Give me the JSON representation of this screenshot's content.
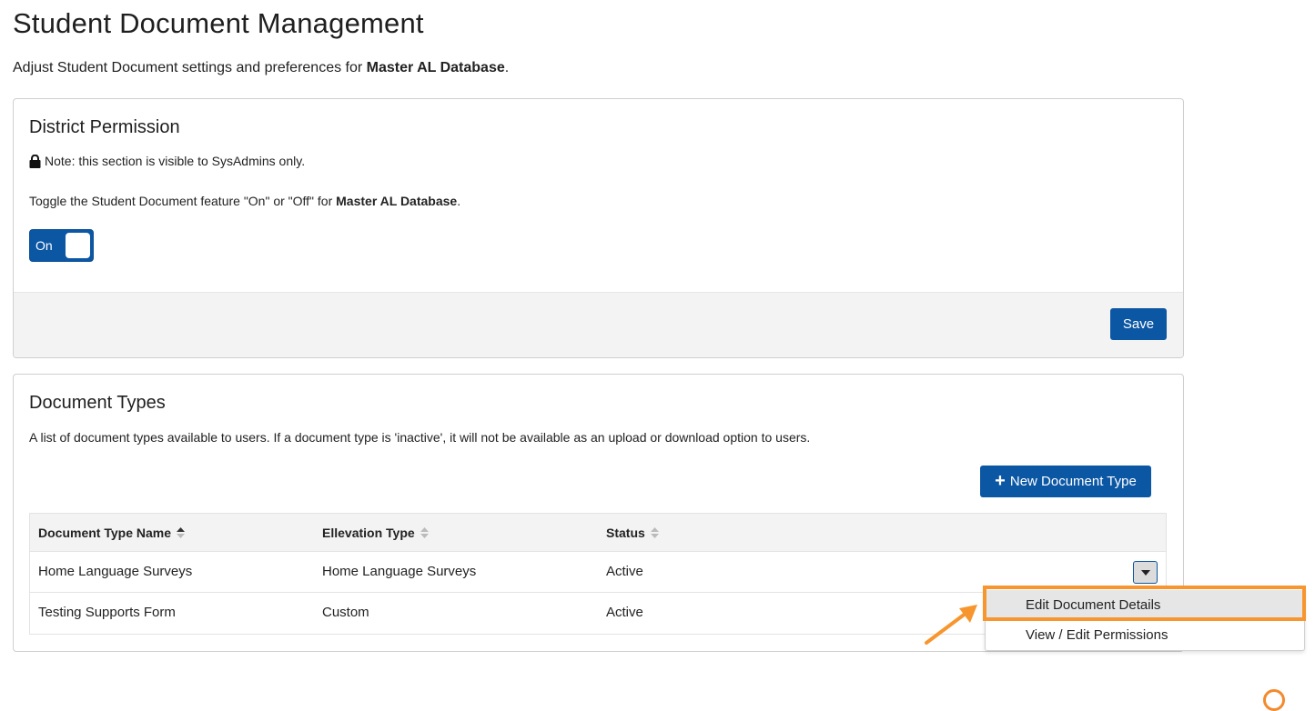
{
  "page": {
    "title": "Student Document Management",
    "subtitle_prefix": "Adjust Student Document settings and preferences for ",
    "database_name": "Master AL Database",
    "subtitle_suffix": "."
  },
  "district_permission": {
    "heading": "District Permission",
    "note_icon": "lock-icon",
    "note": "Note: this section is visible to SysAdmins only.",
    "toggle_desc_prefix": "Toggle the Student Document feature \"On\" or \"Off\" for ",
    "database_name": "Master AL Database",
    "toggle_desc_suffix": ".",
    "toggle_label": "On",
    "save_label": "Save"
  },
  "document_types": {
    "heading": "Document Types",
    "description": "A list of document types available to users. If a document type is 'inactive', it will not be available as an upload or download option to users.",
    "new_button_label": "New Document Type",
    "columns": [
      "Document Type Name",
      "Ellevation Type",
      "Status"
    ],
    "rows": [
      {
        "name": "Home Language Surveys",
        "type": "Home Language Surveys",
        "status": "Active"
      },
      {
        "name": "Testing Supports Form",
        "type": "Custom",
        "status": "Active"
      }
    ],
    "row_menu": {
      "items": [
        "Edit Document Details",
        "View / Edit Permissions"
      ]
    }
  },
  "colors": {
    "primary": "#0c57a4",
    "annotation": "#f7962e"
  }
}
